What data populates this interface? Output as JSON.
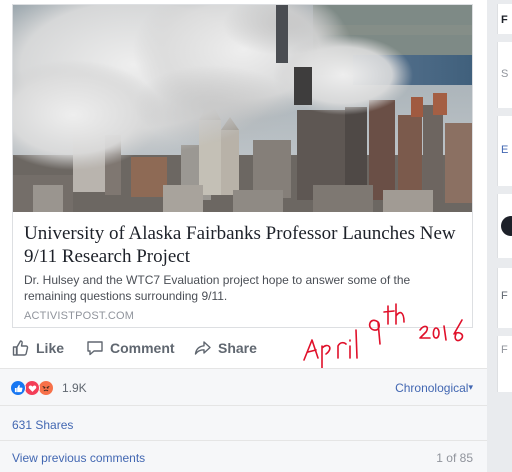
{
  "link_preview": {
    "headline": "University of Alaska Fairbanks Professor Launches New 9/11 Research Project",
    "description": "Dr. Hulsey and the WTC7 Evaluation project hope to answer some of the remaining questions surrounding 9/11.",
    "domain": "ACTIVISTPOST.COM"
  },
  "actions": {
    "like": "Like",
    "comment": "Comment",
    "share": "Share"
  },
  "annotation": {
    "line1": "April 9th",
    "line2": "2016"
  },
  "reactions": {
    "icons": [
      "like-icon",
      "love-icon",
      "angry-icon"
    ],
    "count": "1.9K",
    "sort": "Chronological",
    "sort_caret": "▾"
  },
  "shares": {
    "label": "631 Shares"
  },
  "comments": {
    "view_previous": "View previous comments",
    "pagination": "1 of 85"
  },
  "right_rail": {
    "glyphs": [
      "F",
      "S",
      "E",
      "F",
      "F"
    ]
  },
  "colors": {
    "link": "#4267b2",
    "action_text": "#606770",
    "annotation": "#e0102a",
    "like": "#1877f2",
    "love": "#f33e58",
    "angry": "#f7714a"
  }
}
